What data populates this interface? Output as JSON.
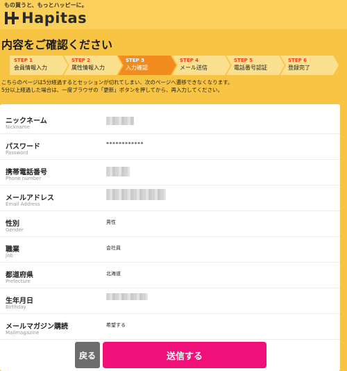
{
  "header": {
    "tagline": "もの買うと、もっとハッピーに。",
    "logo_text": "Hapitas"
  },
  "page_title": "内容をご確認ください",
  "steps": [
    {
      "num": "STEP 1",
      "label": "会員情報入力",
      "active": false
    },
    {
      "num": "STEP 2",
      "label": "属性情報入力",
      "active": false
    },
    {
      "num": "STEP 3",
      "label": "入力確認",
      "active": true
    },
    {
      "num": "STEP 4",
      "label": "メール送信",
      "active": false
    },
    {
      "num": "STEP 5",
      "label": "電話番号認証",
      "active": false
    },
    {
      "num": "STEP 6",
      "label": "登録完了",
      "active": false
    }
  ],
  "notice": {
    "line1": "こちらのページは5分経過するとセッションが切れてしまい、次のページへ遷移できなくなります。",
    "line2": "5分以上経過した場合は、一度ブラウザの「更新」ボタンを押してから、再入力してください。"
  },
  "fields": [
    {
      "label": "ニックネーム",
      "sub": "Nickname",
      "value": ""
    },
    {
      "label": "パスワード",
      "sub": "Password",
      "value": "************"
    },
    {
      "label": "携帯電話番号",
      "sub": "Phone number",
      "value": ""
    },
    {
      "label": "メールアドレス",
      "sub": "Email Address",
      "value": ""
    },
    {
      "label": "性別",
      "sub": "Gender",
      "value": "男性"
    },
    {
      "label": "職業",
      "sub": "Job",
      "value": "会社員"
    },
    {
      "label": "都道府県",
      "sub": "Prefecture",
      "value": "北海道"
    },
    {
      "label": "生年月日",
      "sub": "Birthday",
      "value": ""
    },
    {
      "label": "メールマガジン購読",
      "sub": "Mailmagazine",
      "value": "希望する"
    }
  ],
  "buttons": {
    "back_label": "戻る",
    "send_label": "送信する"
  },
  "colors": {
    "background": "#f8c444",
    "active_step": "#f28c1f",
    "send_button": "#f0107a",
    "back_button": "#6d6d6d"
  }
}
